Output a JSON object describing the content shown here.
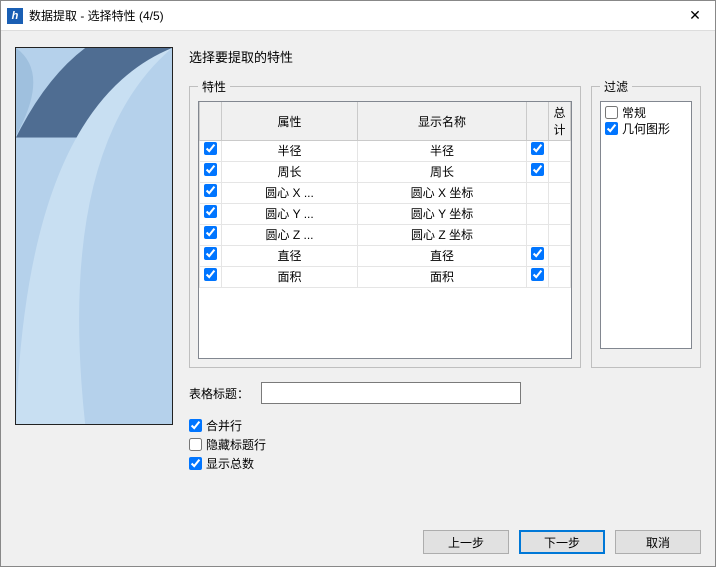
{
  "window": {
    "title": "数据提取 - 选择特性 (4/5)"
  },
  "instruction": "选择要提取的特性",
  "props_legend": "特性",
  "filter_legend": "过滤",
  "columns": {
    "attr": "属性",
    "display": "显示名称",
    "sum": "总计"
  },
  "rows": [
    {
      "on": true,
      "attr": "半径",
      "display": "半径",
      "sum": true
    },
    {
      "on": true,
      "attr": "周长",
      "display": "周长",
      "sum": true
    },
    {
      "on": true,
      "attr": "圆心 X ...",
      "display": "圆心 X 坐标",
      "sum": false
    },
    {
      "on": true,
      "attr": "圆心 Y ...",
      "display": "圆心 Y 坐标",
      "sum": false
    },
    {
      "on": true,
      "attr": "圆心 Z ...",
      "display": "圆心 Z 坐标",
      "sum": false
    },
    {
      "on": true,
      "attr": "直径",
      "display": "直径",
      "sum": true
    },
    {
      "on": true,
      "attr": "面积",
      "display": "面积",
      "sum": true
    }
  ],
  "filters": [
    {
      "label": "常规",
      "checked": false
    },
    {
      "label": "几何图形",
      "checked": true
    }
  ],
  "table_title_label": "表格标题：",
  "table_title_value": "",
  "opts": {
    "merge": {
      "label": "合并行",
      "checked": true
    },
    "hidehdr": {
      "label": "隐藏标题行",
      "checked": false
    },
    "showsum": {
      "label": "显示总数",
      "checked": true
    }
  },
  "buttons": {
    "back": "上一步",
    "next": "下一步",
    "cancel": "取消"
  }
}
